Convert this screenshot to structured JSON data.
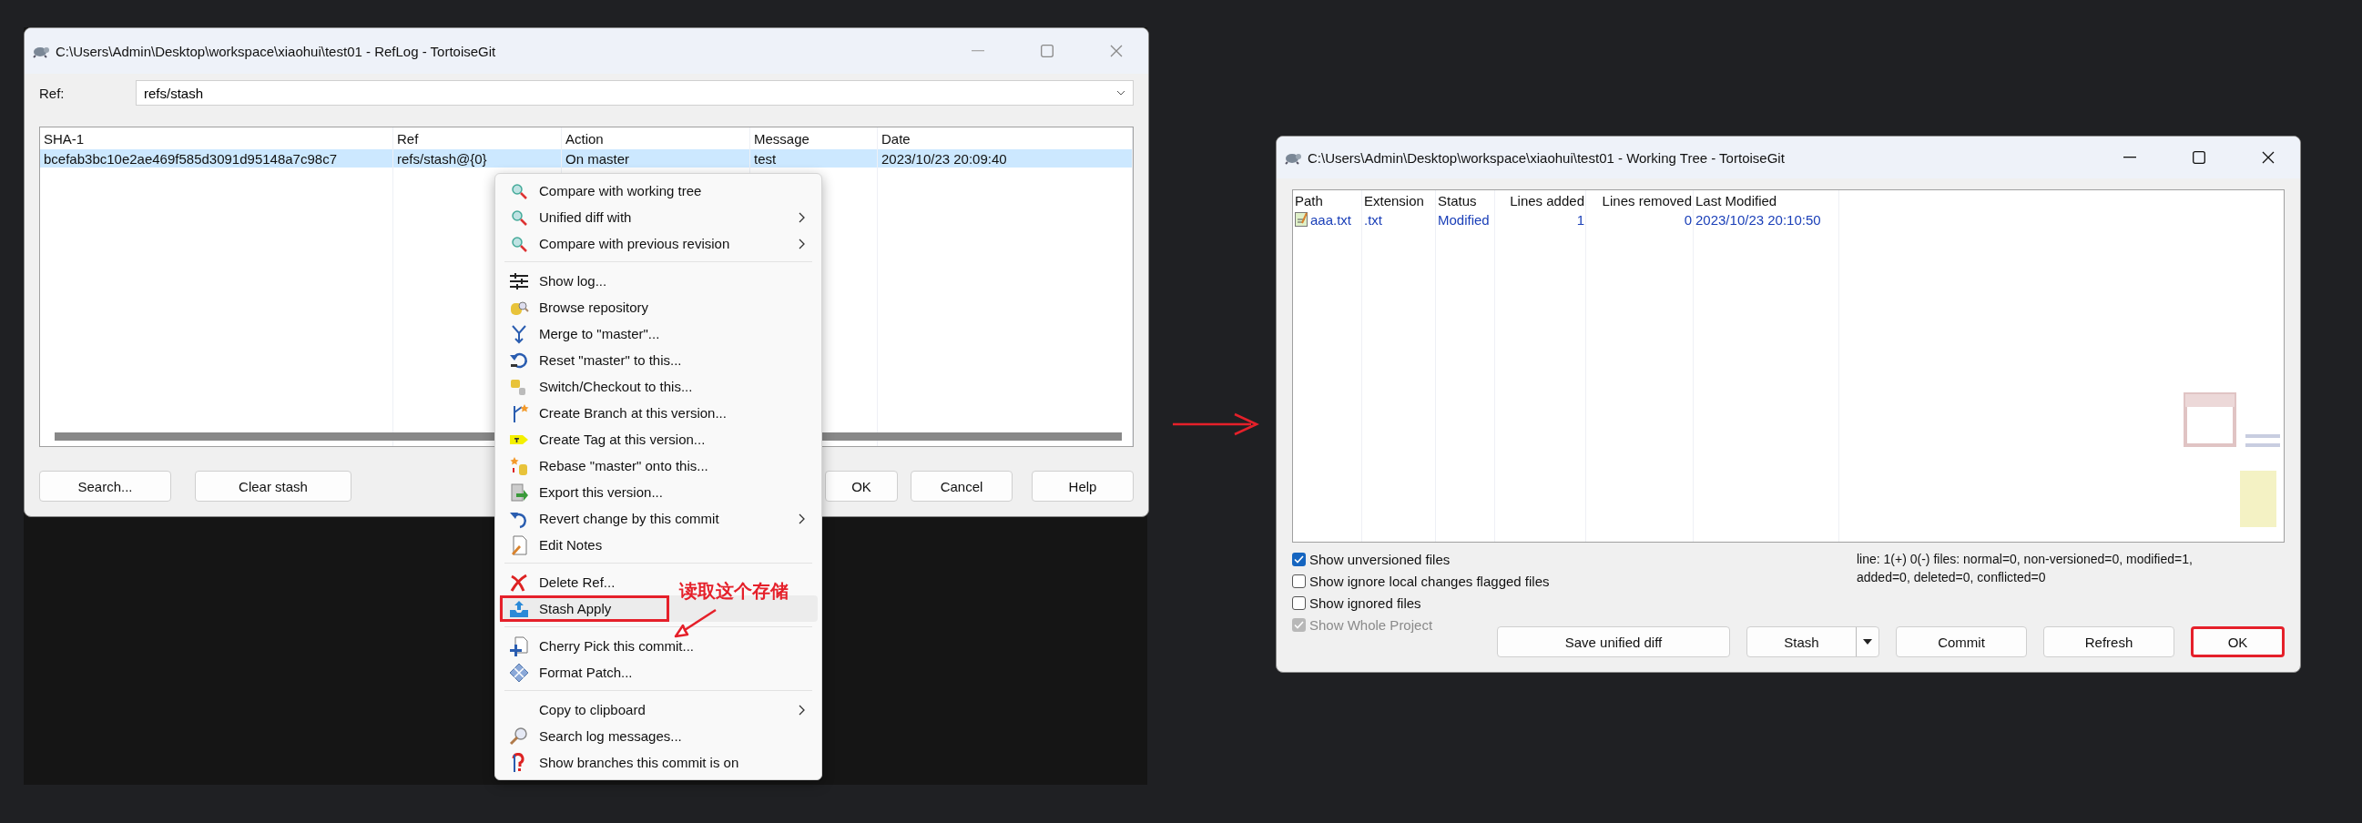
{
  "reflog_window": {
    "title": "C:\\Users\\Admin\\Desktop\\workspace\\xiaohui\\test01 - RefLog - TortoiseGit",
    "ref_label": "Ref:",
    "ref_value": "refs/stash",
    "columns": [
      "SHA-1",
      "Ref",
      "Action",
      "Message",
      "Date"
    ],
    "rows": [
      {
        "selected": true,
        "cells": [
          "bcefab3bc10e2ae469f585d3091d95148a7c98c7",
          "refs/stash@{0}",
          "On master",
          "test",
          "2023/10/23 20:09:40"
        ]
      }
    ],
    "buttons": [
      "Search...",
      "Clear stash",
      "OK",
      "Cancel",
      "Help"
    ]
  },
  "context_menu": {
    "items": [
      {
        "kind": "item",
        "label": "Compare with working tree",
        "submenu": false,
        "highlighted": false
      },
      {
        "kind": "item",
        "label": "Unified diff with",
        "submenu": true,
        "highlighted": false
      },
      {
        "kind": "item",
        "label": "Compare with previous revision",
        "submenu": true,
        "highlighted": false
      },
      {
        "kind": "separator"
      },
      {
        "kind": "item",
        "label": "Show log...",
        "submenu": false,
        "highlighted": false
      },
      {
        "kind": "item",
        "label": "Browse repository",
        "submenu": false,
        "highlighted": false
      },
      {
        "kind": "item",
        "label": "Merge to \"master\"...",
        "submenu": false,
        "highlighted": false
      },
      {
        "kind": "item",
        "label": "Reset \"master\" to this...",
        "submenu": false,
        "highlighted": false
      },
      {
        "kind": "item",
        "label": "Switch/Checkout to this...",
        "submenu": false,
        "highlighted": false
      },
      {
        "kind": "item",
        "label": "Create Branch at this version...",
        "submenu": false,
        "highlighted": false
      },
      {
        "kind": "item",
        "label": "Create Tag at this version...",
        "submenu": false,
        "highlighted": false
      },
      {
        "kind": "item",
        "label": "Rebase \"master\" onto this...",
        "submenu": false,
        "highlighted": false
      },
      {
        "kind": "item",
        "label": "Export this version...",
        "submenu": false,
        "highlighted": false
      },
      {
        "kind": "item",
        "label": "Revert change by this commit",
        "submenu": true,
        "highlighted": false
      },
      {
        "kind": "item",
        "label": "Edit Notes",
        "submenu": false,
        "highlighted": false
      },
      {
        "kind": "separator"
      },
      {
        "kind": "item",
        "label": "Delete Ref...",
        "submenu": false,
        "highlighted": false
      },
      {
        "kind": "item",
        "label": "Stash Apply",
        "submenu": false,
        "highlighted": true
      },
      {
        "kind": "separator"
      },
      {
        "kind": "item",
        "label": "Cherry Pick this commit...",
        "submenu": false,
        "highlighted": false
      },
      {
        "kind": "item",
        "label": "Format Patch...",
        "submenu": false,
        "highlighted": false
      },
      {
        "kind": "separator"
      },
      {
        "kind": "item",
        "label": "Copy to clipboard",
        "submenu": true,
        "highlighted": false
      },
      {
        "kind": "item",
        "label": "Search log messages...",
        "submenu": false,
        "highlighted": false
      },
      {
        "kind": "item",
        "label": "Show branches this commit is on",
        "submenu": false,
        "highlighted": false
      }
    ]
  },
  "annotation": {
    "text": "读取这个存储"
  },
  "working_tree_window": {
    "title": "C:\\Users\\Admin\\Desktop\\workspace\\xiaohui\\test01 - Working Tree - TortoiseGit",
    "columns": [
      "Path",
      "Extension",
      "Status",
      "Lines added",
      "Lines removed",
      "Last Modified"
    ],
    "rows": [
      {
        "cells": [
          "aaa.txt",
          ".txt",
          "Modified",
          "1",
          "0",
          "2023/10/23 20:10:50"
        ]
      }
    ],
    "options": [
      {
        "label": "Show unversioned files",
        "checked": true,
        "disabled": false
      },
      {
        "label": "Show ignore local changes flagged files",
        "checked": false,
        "disabled": false
      },
      {
        "label": "Show ignored files",
        "checked": false,
        "disabled": false
      },
      {
        "label": "Show Whole Project",
        "checked": true,
        "disabled": true
      }
    ],
    "summary": [
      "line: 1(+) 0(-) files: normal=0, non-versioned=0, modified=1,",
      "added=0, deleted=0, conflicted=0"
    ],
    "buttons": [
      {
        "label": "Save unified diff",
        "kind": "plain",
        "marked": false
      },
      {
        "label": "Stash",
        "kind": "split",
        "marked": false
      },
      {
        "label": "Commit",
        "kind": "plain",
        "marked": false
      },
      {
        "label": "Refresh",
        "kind": "plain",
        "marked": false
      },
      {
        "label": "OK",
        "kind": "plain",
        "marked": true
      }
    ]
  }
}
